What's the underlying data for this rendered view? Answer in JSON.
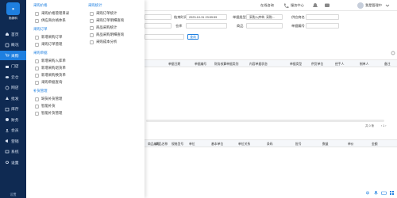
{
  "app": {
    "name": "勤销科"
  },
  "sidebar": {
    "items": [
      {
        "label": "首页",
        "icon": "home-icon"
      },
      {
        "label": "概况",
        "icon": "dashboard-icon"
      },
      {
        "label": "采购",
        "icon": "cart-icon"
      },
      {
        "label": "门店",
        "icon": "store-icon"
      },
      {
        "label": "云仓",
        "icon": "cloud-icon"
      },
      {
        "label": "网店",
        "icon": "shop-icon"
      },
      {
        "label": "批发",
        "icon": "wholesale-icon"
      },
      {
        "label": "库存",
        "icon": "box-icon"
      },
      {
        "label": "财务",
        "icon": "finance-icon"
      },
      {
        "label": "会员",
        "icon": "member-icon"
      },
      {
        "label": "营销",
        "icon": "marketing-icon"
      },
      {
        "label": "系统",
        "icon": "system-icon"
      },
      {
        "label": "设置",
        "icon": "settings-icon"
      }
    ],
    "footer": "设置"
  },
  "topbar": {
    "online_consult": "在线咨询",
    "help_center": "服务中心",
    "user": "我是管理中"
  },
  "menu": {
    "col1": {
      "sections": [
        {
          "title": "采购价格",
          "items": [
            "采购价格管理目录",
            "供应商价格体系"
          ]
        },
        {
          "title": "采购订单",
          "items": [
            "新增采购订单",
            "采购订单管理"
          ]
        },
        {
          "title": "采购单据",
          "items": [
            "新增采购入库单",
            "新增采购退货单",
            "新增采购换货单",
            "采购单据查询"
          ]
        },
        {
          "title": "补货管理",
          "items": [
            "缺货补货管理",
            "智能补货",
            "智能补货管理"
          ]
        }
      ]
    },
    "col2": {
      "sections": [
        {
          "title": "采购统计",
          "items": [
            "采购订单统计",
            "采购订单明细查询",
            "商品采购统计",
            "商品采购明细查询",
            "采购成本分析"
          ]
        }
      ]
    }
  },
  "filters": {
    "date_label": "日期",
    "date_value": "2023-10-01 00:00:00",
    "end_label": "结束时间",
    "end_value": "2023-10-31 23:59:59",
    "type_label": "单据类型",
    "type_value": "采购入库单, 采购...",
    "supplier_label": "供应商名",
    "store_label": "仓库",
    "goods_label": "商品",
    "remark_label": "单据编号",
    "search_button": "查询"
  },
  "table": {
    "headers": [
      "单据日期",
      "单据编号",
      "财务核算单据类别",
      "内容单据状态",
      "单据类型",
      "供货单位",
      "经手人",
      "制单人",
      "备注"
    ],
    "total_pages": "共 0 条",
    "detail_headers": [
      "商品编号",
      "商品名称",
      "规格型号",
      "单位",
      "基本单位",
      "单位关系",
      "条码",
      "批号",
      "数量",
      "单价",
      "金额"
    ]
  },
  "bottom_icons": [
    "language-icon",
    "mic-icon",
    "keyboard-icon",
    "grid-icon"
  ],
  "colors": {
    "sidebar": "#0f2a52",
    "accent": "#1e7fe0"
  }
}
